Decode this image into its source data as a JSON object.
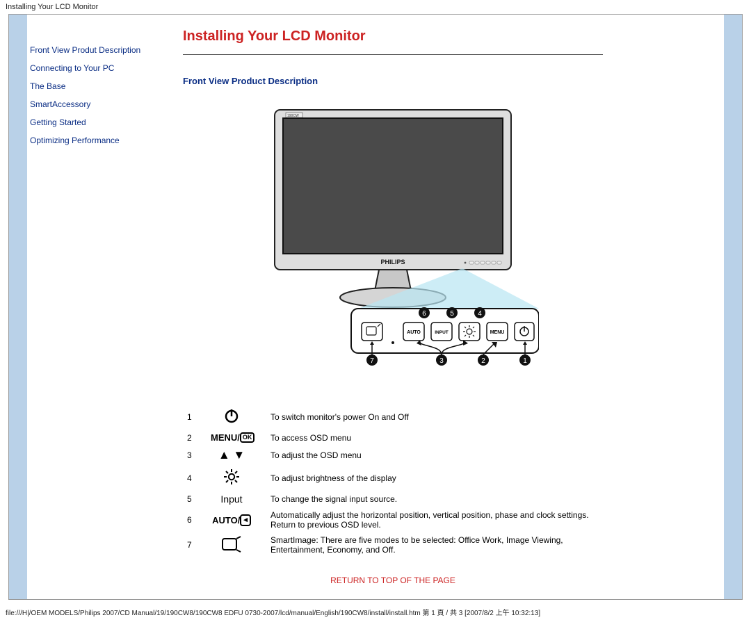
{
  "window_title": "Installing Your LCD Monitor",
  "sidebar": {
    "links": [
      "Front View Produt Description",
      "Connecting to Your PC",
      "The Base",
      "SmartAccessory",
      "Getting Started",
      "Optimizing Performance"
    ]
  },
  "page_title": "Installing Your LCD Monitor",
  "section_title": "Front View Product Description",
  "monitor_brand": "PHILIPS",
  "monitor_model": "190CW",
  "callouts_top": [
    "6",
    "5",
    "4"
  ],
  "callouts_bottom": [
    "7",
    "3",
    "2",
    "1"
  ],
  "button_labels": [
    "AUTO",
    "INPUT",
    "MENU"
  ],
  "table": {
    "rows": [
      {
        "num": "1",
        "icon_label": "power-icon",
        "icon_text": "",
        "desc": "To switch monitor's power On and Off"
      },
      {
        "num": "2",
        "icon_label": "menu-ok-icon",
        "icon_text": "MENU/OK",
        "desc": "To access OSD menu"
      },
      {
        "num": "3",
        "icon_label": "up-down-icon",
        "icon_text": "▲ ▼",
        "desc": "To adjust the OSD menu"
      },
      {
        "num": "4",
        "icon_label": "brightness-icon",
        "icon_text": "",
        "desc": "To adjust brightness of the display"
      },
      {
        "num": "5",
        "icon_label": "input-icon",
        "icon_text": "Input",
        "desc": "To change the signal input source."
      },
      {
        "num": "6",
        "icon_label": "auto-back-icon",
        "icon_text": "AUTO/◀",
        "desc": "Automatically adjust the horizontal position, vertical position, phase and clock settings.\nReturn to previous OSD level."
      },
      {
        "num": "7",
        "icon_label": "smartimage-icon",
        "icon_text": "",
        "desc": "SmartImage: There are five modes to be selected: Office Work, Image Viewing, Entertainment, Economy, and Off."
      }
    ]
  },
  "return_link": "RETURN TO TOP OF THE PAGE",
  "footer_path": "file:///H|/OEM MODELS/Philips 2007/CD Manual/19/190CW8/190CW8 EDFU 0730-2007/lcd/manual/English/190CW8/install/install.htm 第 1 頁 / 共 3  [2007/8/2 上午 10:32:13]"
}
